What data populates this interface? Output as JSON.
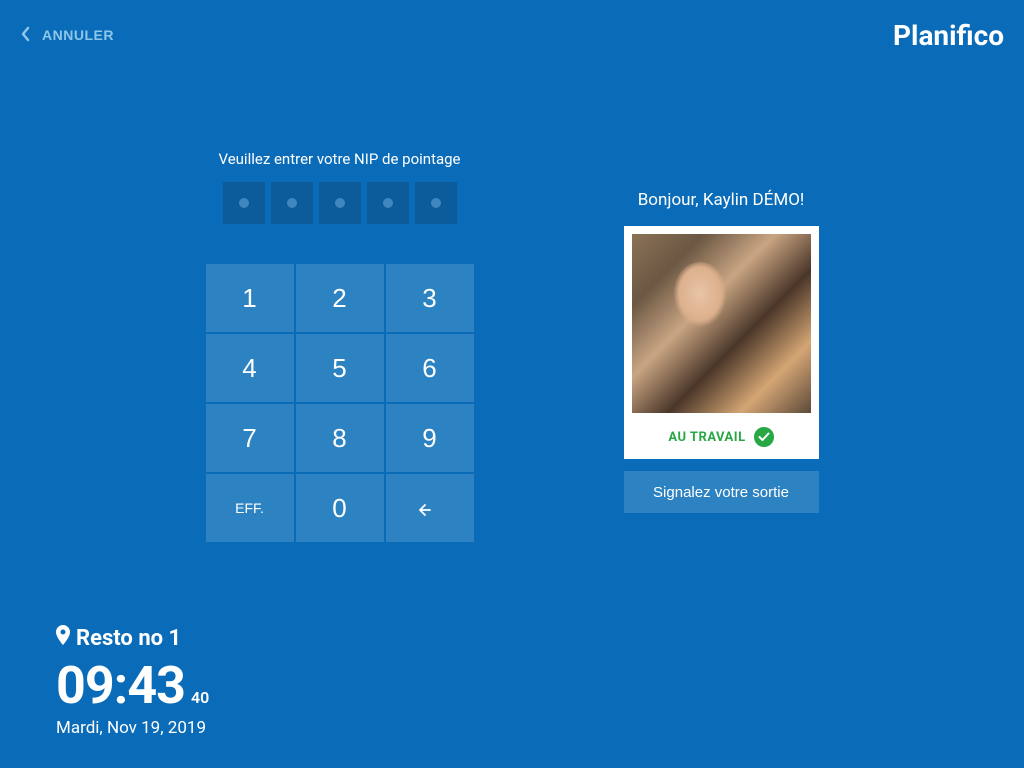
{
  "header": {
    "cancel_label": "ANNULER",
    "brand": "Planifico"
  },
  "pin": {
    "prompt": "Veuillez entrer votre NIP de pointage",
    "length": 5
  },
  "keypad": {
    "keys": [
      "1",
      "2",
      "3",
      "4",
      "5",
      "6",
      "7",
      "8",
      "9"
    ],
    "clear_label": "EFF.",
    "zero": "0",
    "backspace_icon": "backspace"
  },
  "user": {
    "greeting": "Bonjour, Kaylin DÉMO!",
    "status_label": "AU TRAVAIL",
    "status_color": "#28a745"
  },
  "actions": {
    "signout_label": "Signalez votre sortie"
  },
  "footer": {
    "location_name": "Resto no 1",
    "clock_main": "09:43",
    "clock_seconds": "40",
    "date_line": "Mardi, Nov 19, 2019"
  }
}
